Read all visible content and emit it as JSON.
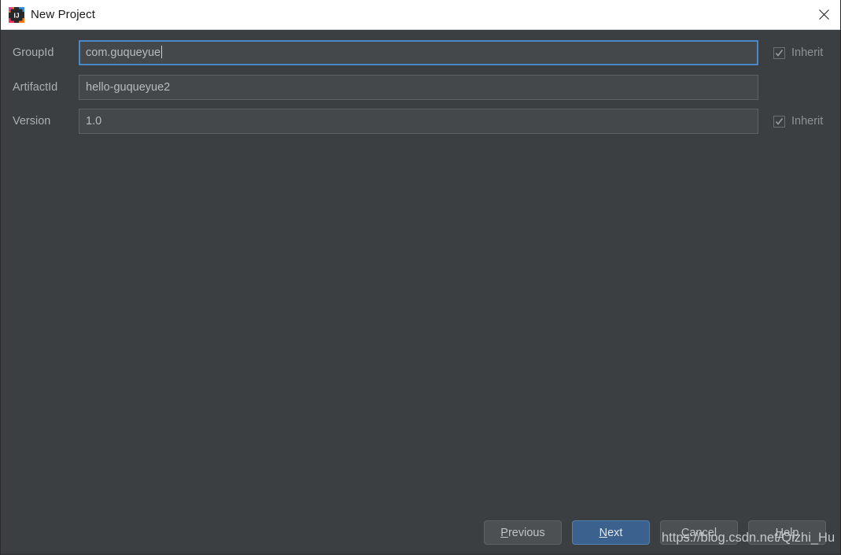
{
  "window": {
    "title": "New Project",
    "app_icon": "intellij-idea-icon",
    "close_icon": "close-icon",
    "background_color": "#3c3f41",
    "titlebar_color": "#ffffff"
  },
  "form": {
    "rows": [
      {
        "label": "GroupId",
        "value": "com.guqueyue",
        "placeholder": "",
        "focused": true,
        "has_inherit": true,
        "inherit_label": "Inherit",
        "inherit_checked": true
      },
      {
        "label": "ArtifactId",
        "value": "hello-guqueyue2",
        "placeholder": "",
        "focused": false,
        "has_inherit": false,
        "inherit_label": "",
        "inherit_checked": false
      },
      {
        "label": "Version",
        "value": "1.0",
        "placeholder": "",
        "focused": false,
        "has_inherit": true,
        "inherit_label": "Inherit",
        "inherit_checked": true
      }
    ]
  },
  "buttons": {
    "previous": {
      "label": "Previous",
      "mnemonic": "P",
      "rest": "revious",
      "default": false
    },
    "next": {
      "label": "Next",
      "mnemonic": "N",
      "rest": "ext",
      "default": true
    },
    "cancel": {
      "label": "Cancel",
      "mnemonic": "C",
      "rest": "ancel",
      "default": false
    },
    "help": {
      "label": "Help",
      "mnemonic": "H",
      "rest": "elp",
      "default": false
    }
  },
  "watermark": {
    "text": "https://blog.csdn.net/Qizhi_Hu"
  },
  "colors": {
    "accent": "#3b618e",
    "focus_border": "#4a88c7",
    "field_bg": "#45484a",
    "dialog_bg": "#3c3f41",
    "label_text": "#a9b0b5"
  }
}
